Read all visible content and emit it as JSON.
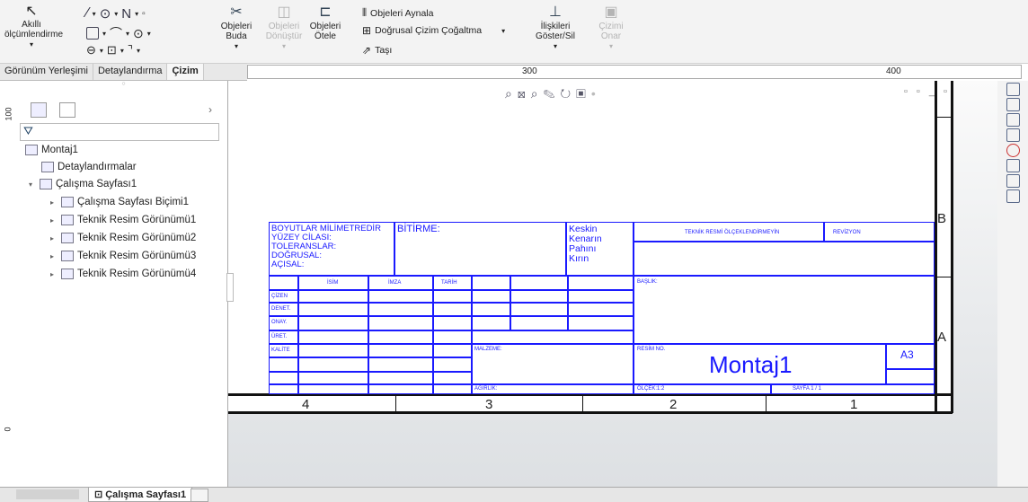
{
  "ribbon": {
    "smart_dimension": "Akıllı ölçümlendirme",
    "trim": "Objeleri Buda",
    "convert": "Objeleri Dönüştür",
    "offset": "Objeleri Ötele",
    "mirror": "Objeleri Aynala",
    "linear_pattern": "Doğrusal Çizim Çoğaltma",
    "move": "Taşı",
    "relations": "İlişkileri Göster/Sil",
    "quick_snaps": "Çizimi Onar"
  },
  "tabs": [
    "Görünüm Yerleşimi",
    "Detaylandırma",
    "Çizim"
  ],
  "active_tab": "Çizim",
  "ruler": {
    "top_labels": [
      "300",
      "400"
    ],
    "left_labels": [
      "100",
      "0"
    ]
  },
  "tree": {
    "root": "Montaj1",
    "items": [
      "Detaylandırmalar",
      "Çalışma Sayfası1",
      "Çalışma Sayfası Biçimi1",
      "Teknik Resim Görünümü1",
      "Teknik Resim Görünümü2",
      "Teknik Resim Görünümü3",
      "Teknik Resim Görünümü4"
    ]
  },
  "title_block": {
    "dims_note": [
      "BOYUTLAR MİLİMETREDİR",
      "YÜZEY CİLASI:",
      "TOLERANSLAR:",
      "DOĞRUSAL:",
      "AÇISAL:"
    ],
    "finish": "BİTİRME:",
    "edges": [
      "Keskin",
      "Kenarın",
      "Pahını",
      "Kırın"
    ],
    "no_scale": "TEKNİK RESMİ ÖLÇEKLENDİRMEYİN",
    "revision": "REVİZYON",
    "col_headers": [
      "İSİM",
      "İMZA",
      "TARİH"
    ],
    "row_labels": [
      "ÇİZEN",
      "DENET.",
      "ONAY.",
      "ÜRET.",
      "KALİTE"
    ],
    "title_label": "BAŞLIK:",
    "material": "MALZEME:",
    "drawing_no": "RESİM NO.",
    "part_name": "Montaj1",
    "size": "A3",
    "weight": "AĞIRLIK:",
    "scale": "ÖLÇEK:1:2",
    "sheet": "SAYFA 1 / 1"
  },
  "zones": {
    "columns": [
      "4",
      "3",
      "2",
      "1"
    ],
    "rows": [
      "B",
      "A"
    ]
  },
  "bottom_tab": "Çalışma Sayfası1"
}
